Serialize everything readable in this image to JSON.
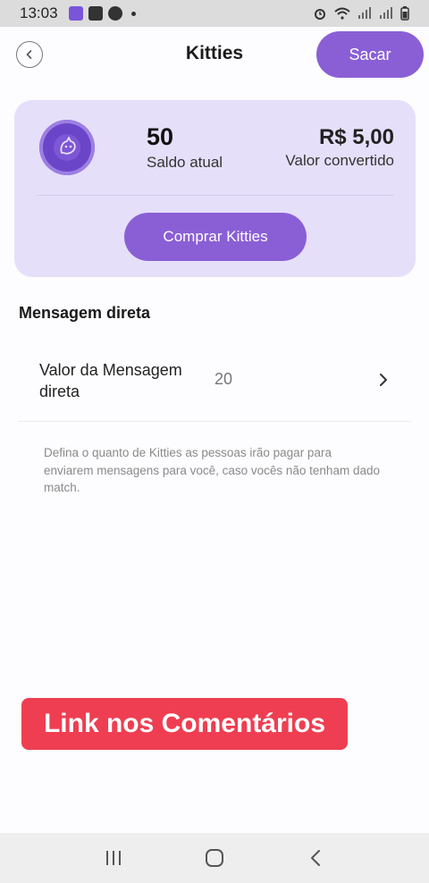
{
  "status_bar": {
    "time": "13:03",
    "icons_left": [
      "app-icon",
      "gallery-icon",
      "circle-app-icon",
      "notification-dot"
    ],
    "icons_right": [
      "alarm-icon",
      "wifi-icon",
      "signal-icon",
      "signal-icon",
      "battery-icon"
    ]
  },
  "header": {
    "title": "Kitties",
    "back_icon": "back-icon",
    "action_label": "Sacar"
  },
  "balance": {
    "coin_icon": "kitty-coin-icon",
    "value": "50",
    "value_label": "Saldo atual",
    "converted": "R$ 5,00",
    "converted_label": "Valor convertido",
    "buy_label": "Comprar Kitties"
  },
  "direct_message": {
    "section_title": "Mensagem direta",
    "row_label": "Valor da Mensagem direta",
    "row_value": "20",
    "help_text": "Defina o quanto de Kitties as pessoas irão pagar para enviarem mensagens para você, caso vocês não tenham dado match."
  },
  "overlay": {
    "banner_text": "Link nos Comentários"
  },
  "navigation": {
    "buttons": [
      "recents-icon",
      "home-icon",
      "back-nav-icon"
    ]
  },
  "colors": {
    "accent": "#8a5fd6",
    "card_bg": "#e6dffa",
    "banner": "#ef3e51"
  }
}
